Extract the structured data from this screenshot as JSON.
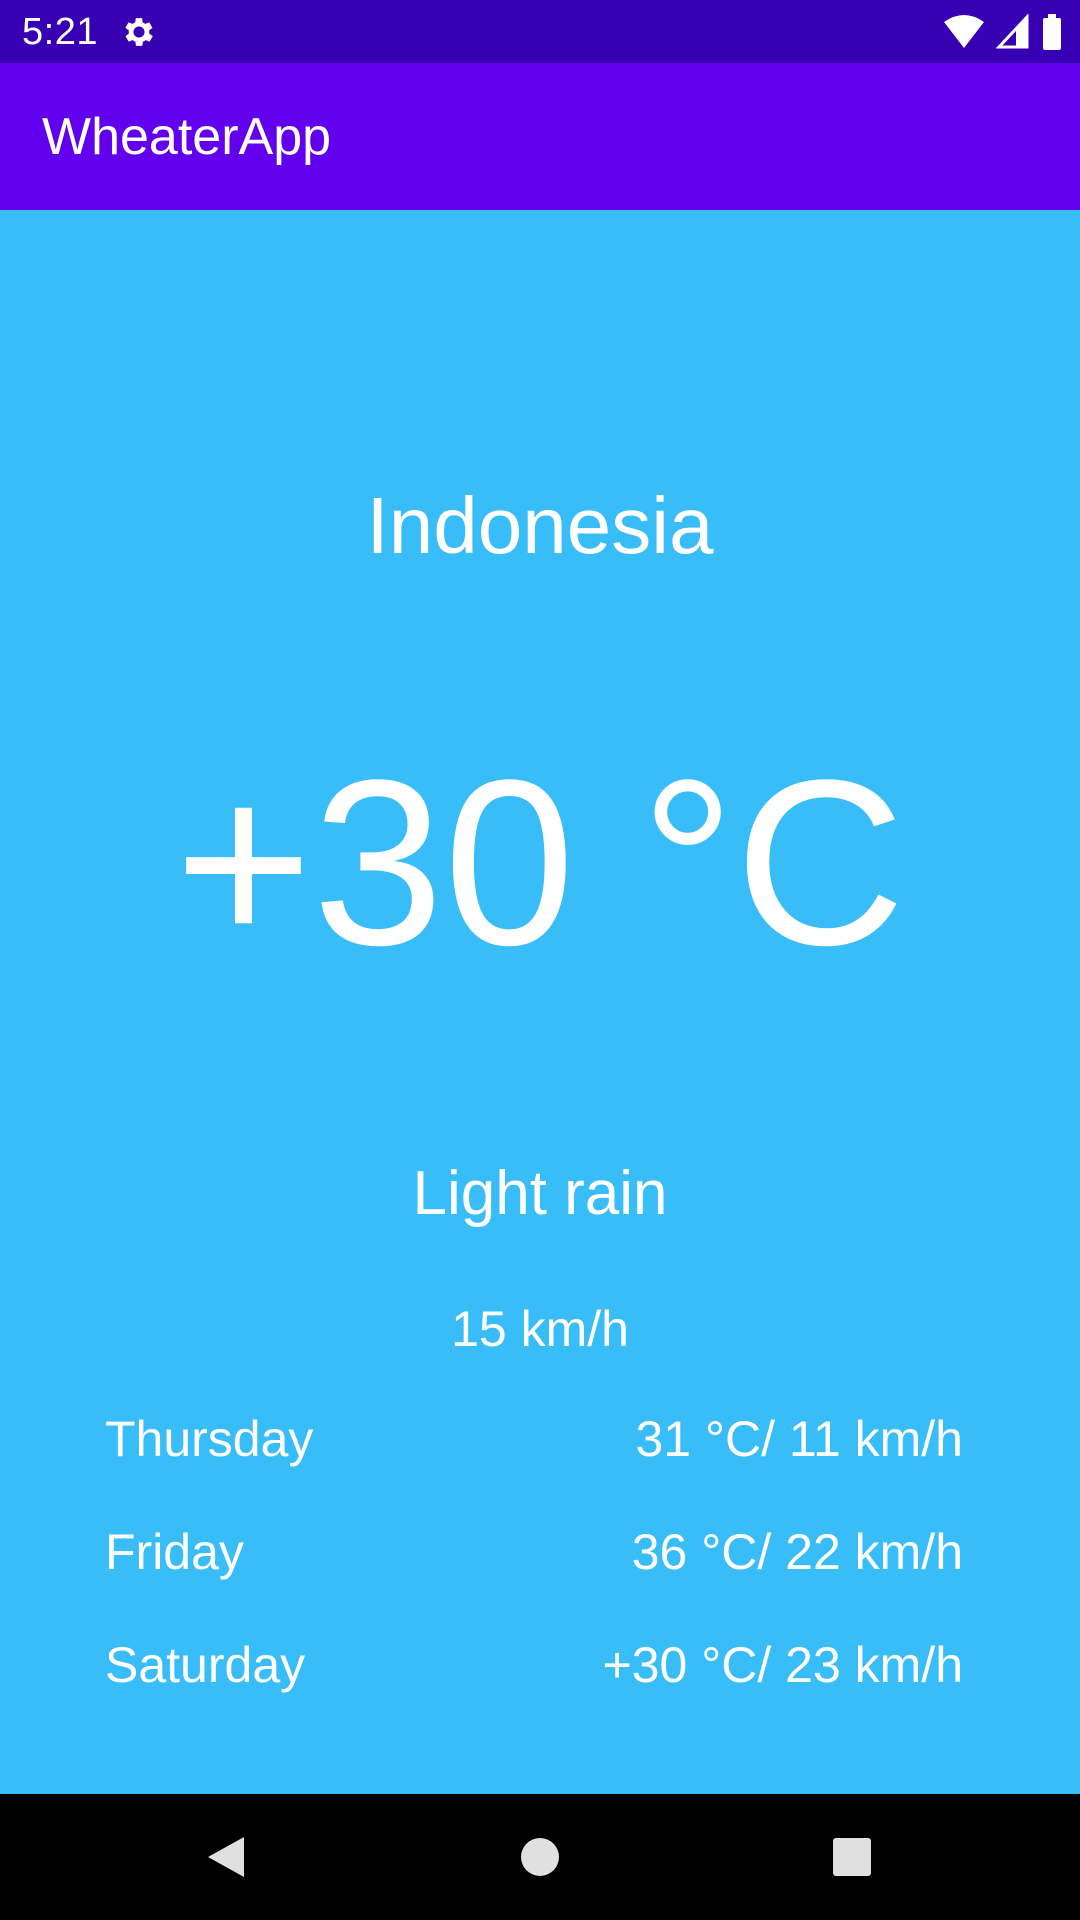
{
  "status_bar": {
    "time": "5:21",
    "icons": [
      "gear-icon",
      "wifi-icon",
      "cell-signal-icon",
      "battery-icon"
    ]
  },
  "app_bar": {
    "title": "WheaterApp"
  },
  "weather": {
    "location": "Indonesia",
    "temperature": "+30 °C",
    "description": "Light rain",
    "wind": "15 km/h"
  },
  "forecast": [
    {
      "day": "Thursday",
      "value": "31 °C/ 11 km/h"
    },
    {
      "day": "Friday",
      "value": "36 °C/ 22 km/h"
    },
    {
      "day": "Saturday",
      "value": "+30 °C/ 23 km/h"
    }
  ],
  "nav_bar": {
    "icons": [
      "back-icon",
      "home-icon",
      "recents-icon"
    ]
  },
  "colors": {
    "status_bar": "#3700B3",
    "app_bar": "#6200EE",
    "content_background": "#39BDF8",
    "text": "#FFFFFF",
    "nav_bar": "#000000"
  }
}
